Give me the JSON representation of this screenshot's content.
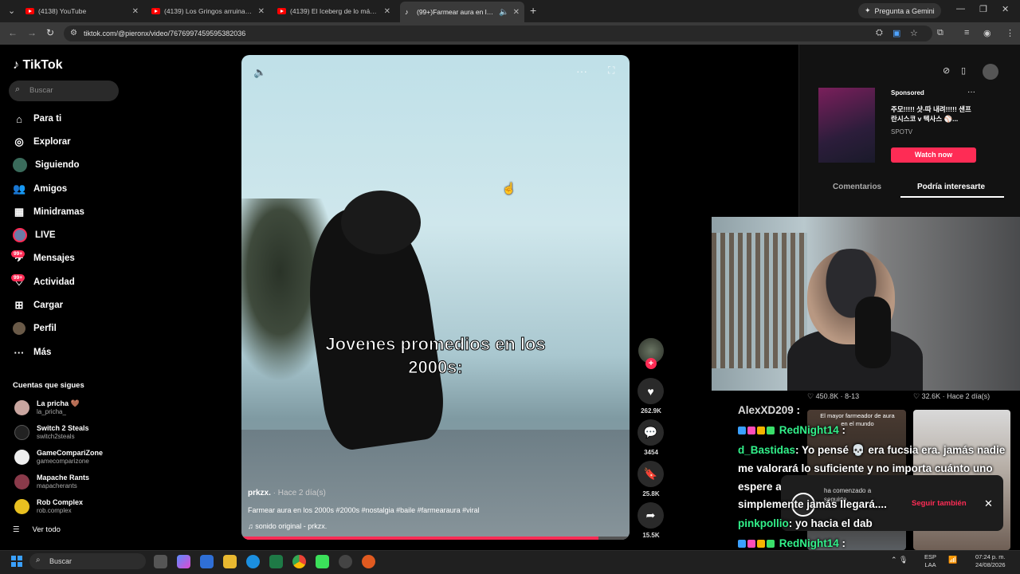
{
  "browser": {
    "tabs": [
      {
        "title": "(4138) YouTube"
      },
      {
        "title": "(4139) Los Gringos arruinaron l..."
      },
      {
        "title": "(4139) El Iceberg de lo más Pe..."
      },
      {
        "title": "(99+)Farmear aura en los 20..."
      }
    ],
    "gemini_label": "Pregunta a Gemini",
    "url": "tiktok.com/@pieronx/video/7676997459595382036"
  },
  "sidebar": {
    "logo": "TikTok",
    "search_placeholder": "Buscar",
    "nav": [
      {
        "label": "Para ti",
        "icon": "home-icon"
      },
      {
        "label": "Explorar",
        "icon": "compass-icon"
      },
      {
        "label": "Siguiendo",
        "icon": "following-avatar-icon"
      },
      {
        "label": "Amigos",
        "icon": "friends-icon"
      },
      {
        "label": "Minidramas",
        "icon": "film-icon"
      },
      {
        "label": "LIVE",
        "icon": "live-icon"
      },
      {
        "label": "Mensajes",
        "icon": "message-icon",
        "badge": "99+"
      },
      {
        "label": "Actividad",
        "icon": "activity-icon",
        "badge": "99+"
      },
      {
        "label": "Cargar",
        "icon": "upload-icon"
      },
      {
        "label": "Perfil",
        "icon": "profile-icon"
      },
      {
        "label": "Más",
        "icon": "more-icon"
      }
    ],
    "following_title": "Cuentas que sigues",
    "accounts": [
      {
        "name": "La pricha 🤎",
        "handle": "la_pricha_"
      },
      {
        "name": "Switch 2 Steals",
        "handle": "switch2steals"
      },
      {
        "name": "GameCompariZone",
        "handle": "gamecomparizone"
      },
      {
        "name": "Mapache Rants",
        "handle": "mapacherants"
      },
      {
        "name": "Rob Complex",
        "handle": "rob.complex"
      }
    ],
    "see_all": "Ver todo"
  },
  "video": {
    "caption_line1": "Jovenes promedios en los",
    "caption_line2": "2000s:",
    "author": "prkzx.",
    "time": " · Hace 2 día(s)",
    "description": "Farmear aura en los 2000s #2000s #nostalgia #baile #farmearaura #viral",
    "sound": "sonido original - prkzx.",
    "progress": 0.92
  },
  "actions": {
    "likes": "262.9K",
    "comments": "3454",
    "saves": "25.8K",
    "shares": "15.5K"
  },
  "right_panel": {
    "ad_sponsored": "Sponsored",
    "ad_title": "주모!!!!! 샷-따 내려!!!!! 샌프란시스코 v 텍사스 ⚾️...",
    "ad_brand": "SPOTV",
    "ad_button": "Watch now",
    "tab_comments": "Comentarios",
    "tab_interesting": "Podría interesarte",
    "rec1_stat": "♡ 450.8K · 8-13",
    "rec1_title": "El mayor farmeador de aura en el mundo",
    "rec2_stat": "♡ 32.6K · Hace 2 día(s)"
  },
  "chat": [
    {
      "user": "AlexXD209",
      "text": "",
      "color": "grey"
    },
    {
      "user": "RedNight14",
      "text": "",
      "color": "green"
    },
    {
      "user": "d_Bastidas",
      "text": ": Yo pensé 💀 era fucsia era. jamás nadie",
      "color": "green"
    },
    {
      "user": "",
      "text": "me valorará lo suficiente y no importa cuánto uno",
      "color": "grey"
    },
    {
      "user": "",
      "text": "espere a esa persona 💀 te haga sentir especial,",
      "color": "grey"
    },
    {
      "user": "",
      "text": "simplemente jamás llegará....",
      "color": "grey"
    },
    {
      "user": "pinkpollio",
      "text": ": yo hacia el dab",
      "color": "green"
    },
    {
      "user": "RedNight14",
      "text": "",
      "color": "green"
    }
  ],
  "toast": {
    "message": "ha comenzado a seguirte.",
    "button": "Seguir también"
  },
  "taskbar": {
    "search": "Buscar",
    "lang_line1": "ESP",
    "lang_line2": "LAA",
    "time": "07:24 p. m.",
    "date": "24/08/2026"
  }
}
